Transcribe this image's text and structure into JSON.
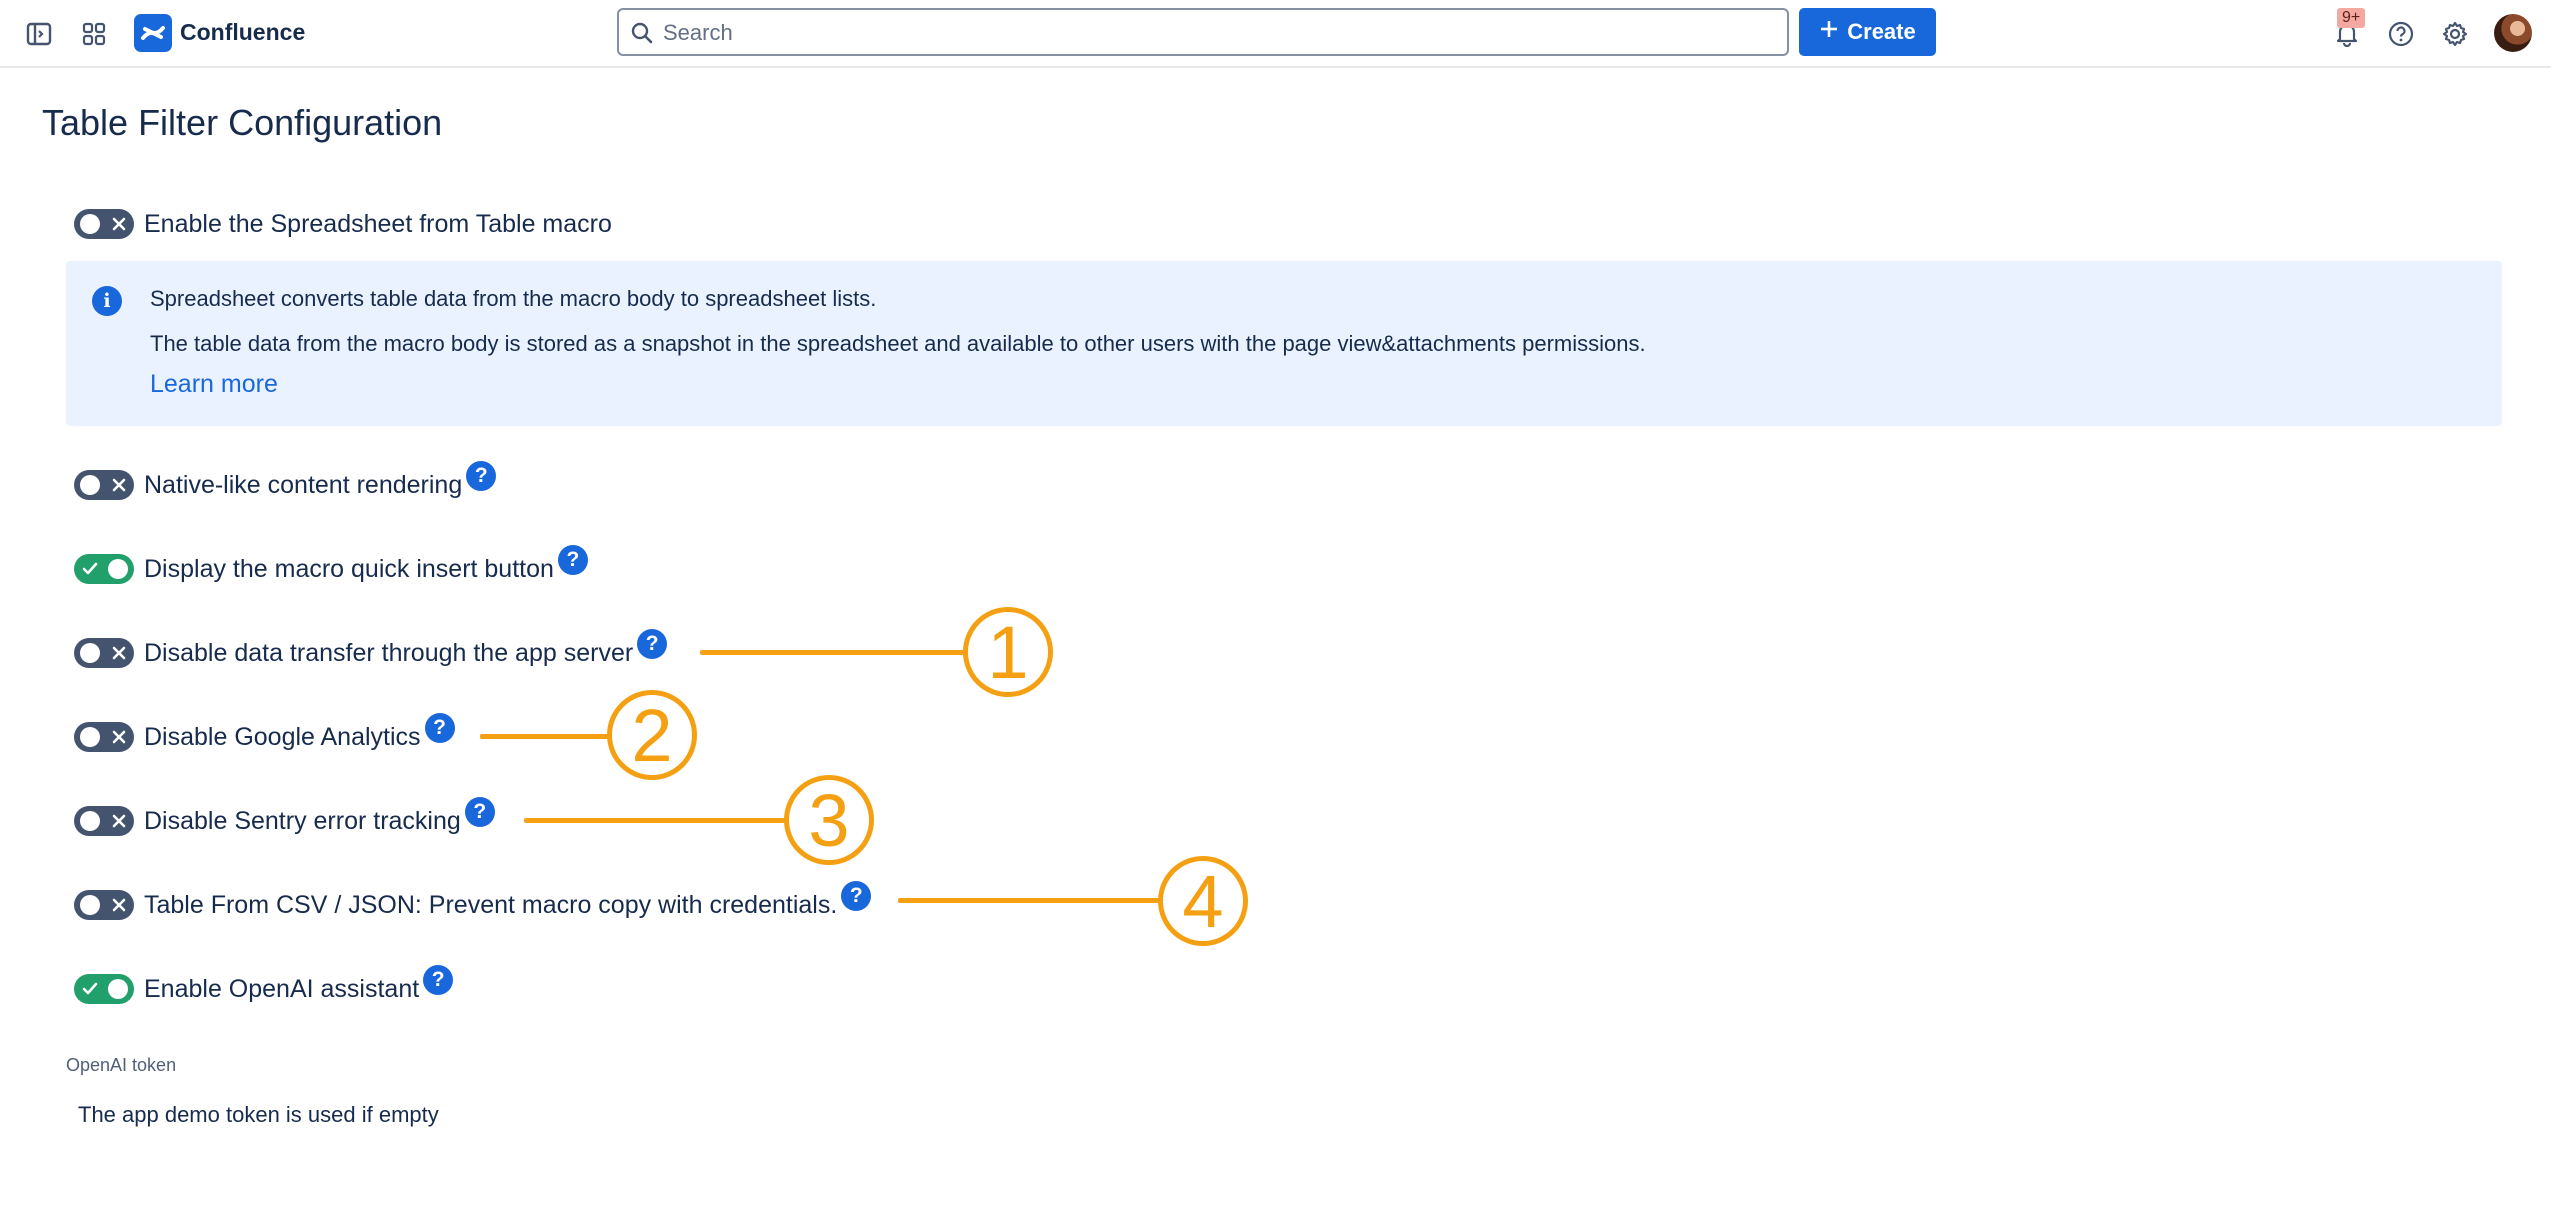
{
  "header": {
    "brand": "Confluence",
    "search_placeholder": "Search",
    "create_label": "Create",
    "notification_badge": "9+",
    "icons": [
      "sidebar-toggle-icon",
      "app-switcher-icon",
      "confluence-logo-icon",
      "search-icon",
      "plus-icon",
      "bell-icon",
      "help-icon",
      "gear-icon"
    ],
    "colors": {
      "primary": "#1868db",
      "text": "#172b4d"
    }
  },
  "page": {
    "title": "Table Filter Configuration"
  },
  "settings": [
    {
      "label": "Enable the Spreadsheet from Table macro",
      "enabled": false,
      "help": false
    },
    {
      "label": "Native-like content rendering",
      "enabled": false,
      "help": true
    },
    {
      "label": "Display the macro quick insert button",
      "enabled": true,
      "help": true
    },
    {
      "label": "Disable data transfer through the app server",
      "enabled": false,
      "help": true
    },
    {
      "label": "Disable Google Analytics",
      "enabled": false,
      "help": true
    },
    {
      "label": "Disable Sentry error tracking",
      "enabled": false,
      "help": true
    },
    {
      "label": "Table From CSV / JSON: Prevent macro copy with credentials.",
      "enabled": false,
      "help": true
    },
    {
      "label": "Enable OpenAI assistant",
      "enabled": true,
      "help": true
    }
  ],
  "info": {
    "line1": "Spreadsheet converts table data from the macro body to spreadsheet lists.",
    "line2": "The table data from the macro body is stored as a snapshot in the spreadsheet and available to other users with the page view&attachments permissions.",
    "learn_more": "Learn more",
    "icon_glyph": "i"
  },
  "help_glyph": "?",
  "openai": {
    "token_label": "OpenAI token",
    "token_placeholder": "The app demo token is used if empty"
  },
  "annotations": {
    "color": "#f5a012",
    "markers": [
      "1",
      "2",
      "3",
      "4"
    ]
  }
}
